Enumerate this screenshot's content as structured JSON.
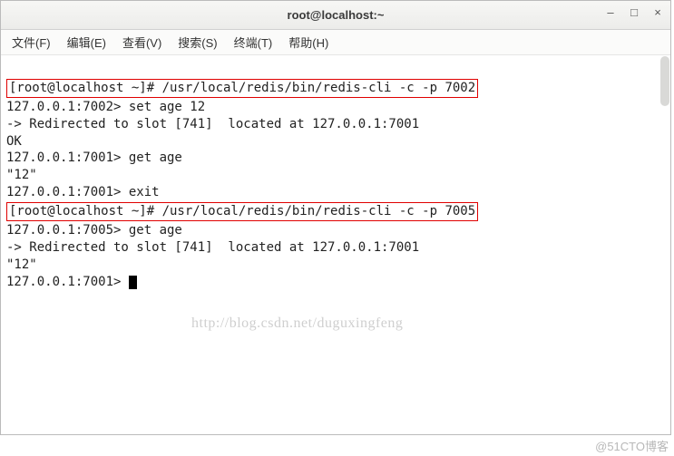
{
  "titlebar": {
    "title": "root@localhost:~"
  },
  "menu": {
    "file": "文件(F)",
    "edit": "编辑(E)",
    "view": "查看(V)",
    "search": "搜索(S)",
    "terminal": "终端(T)",
    "help": "帮助(H)"
  },
  "lines": {
    "cmd1_prompt": "[root@localhost ~]# ",
    "cmd1_cmd": "/usr/local/redis/bin/redis-cli -c -p 7002",
    "l2": "127.0.0.1:7002> set age 12",
    "l3": "-> Redirected to slot [741]  located at 127.0.0.1:7001",
    "l4": "OK",
    "l5": "127.0.0.1:7001> get age",
    "l6": "\"12\"",
    "l7": "127.0.0.1:7001> exit",
    "cmd2_prompt": "[root@localhost ~]# ",
    "cmd2_cmd": "/usr/local/redis/bin/redis-cli -c -p 7005",
    "l9": "127.0.0.1:7005> get age",
    "l10": "-> Redirected to slot [741]  located at 127.0.0.1:7001",
    "l11": "\"12\"",
    "l12": "127.0.0.1:7001> "
  },
  "watermark": "http://blog.csdn.net/duguxingfeng",
  "footer": "@51CTO博客"
}
